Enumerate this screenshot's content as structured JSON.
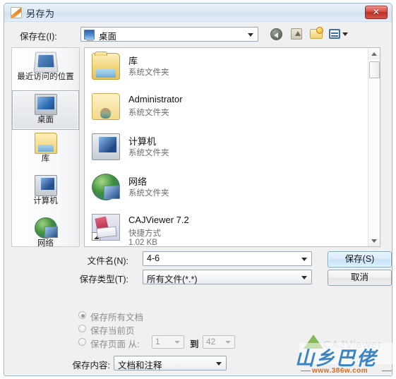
{
  "window": {
    "title": "另存为",
    "title_icon": "save-as-document-icon",
    "close_label": "✕"
  },
  "toolbar": {
    "save_in_label": "保存在(I):",
    "current_path": "桌面",
    "path_icon": "desktop-monitor-icon",
    "buttons": [
      {
        "name": "back-button",
        "icon": "back-arrow-icon"
      },
      {
        "name": "up-one-level-button",
        "icon": "up-folder-arrow-icon"
      },
      {
        "name": "new-folder-button",
        "icon": "new-folder-icon"
      },
      {
        "name": "views-button",
        "icon": "views-grid-icon"
      }
    ]
  },
  "places": [
    {
      "label": "最近访问的位置",
      "icon": "recent-places-icon",
      "selected": false
    },
    {
      "label": "桌面",
      "icon": "desktop-icon",
      "selected": true
    },
    {
      "label": "库",
      "icon": "libraries-icon",
      "selected": false
    },
    {
      "label": "计算机",
      "icon": "computer-icon",
      "selected": false
    },
    {
      "label": "网络",
      "icon": "network-icon",
      "selected": false
    }
  ],
  "files": [
    {
      "name": "库",
      "type": "系统文件夹",
      "size": "",
      "icon": "library-folder-icon"
    },
    {
      "name": "Administrator",
      "type": "系统文件夹",
      "size": "",
      "icon": "user-folder-icon"
    },
    {
      "name": "计算机",
      "type": "系统文件夹",
      "size": "",
      "icon": "computer-icon"
    },
    {
      "name": "网络",
      "type": "系统文件夹",
      "size": "",
      "icon": "network-icon"
    },
    {
      "name": "CAJViewer 7.2",
      "type": "快捷方式",
      "size": "1.02 KB",
      "icon": "cajviewer-shortcut-icon"
    }
  ],
  "form": {
    "filename_label": "文件名(N):",
    "filename_value": "4-6",
    "filetype_label": "保存类型(T):",
    "filetype_value": "所有文件(*.*)",
    "save_button": "保存(S)",
    "cancel_button": "取消"
  },
  "options": {
    "radios": [
      {
        "label": "保存所有文档",
        "checked": true
      },
      {
        "label": "保存当前页",
        "checked": false
      },
      {
        "label": "保存页面 从:",
        "checked": false
      }
    ],
    "page_from": "1",
    "page_to_label": "到",
    "page_to": "42",
    "content_label": "保存内容:",
    "content_value": "文档和注释"
  },
  "watermark": {
    "characters": "山乡巴佬",
    "url": "www.386w.com",
    "ghost_text": "CAJViewer"
  },
  "colors": {
    "title_bar": "#dce9f4",
    "close_button": "#bc2f27",
    "primary_button": "#c6e2f7",
    "selection": "#dfe3e8",
    "watermark_blue": "#2f7fc4",
    "watermark_orange": "#d56a1f",
    "watermark_green": "#7ab648"
  }
}
